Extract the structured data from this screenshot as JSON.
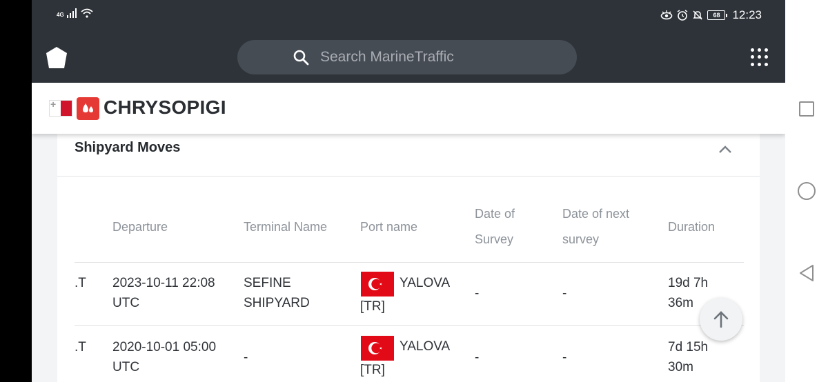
{
  "status_bar": {
    "network": "4G",
    "battery": "68",
    "time": "12:23"
  },
  "header": {
    "search_placeholder": "Search MarineTraffic"
  },
  "vessel": {
    "name": "CHRYSOPIGI",
    "flag": "Malta",
    "type_icon": "tanker-drops-icon"
  },
  "section": {
    "title": "Shipyard Moves",
    "columns": [
      "Departure",
      "Terminal Name",
      "Port name",
      "Date of",
      "Survey",
      "Date of next",
      "survey",
      "Duration"
    ],
    "rows": [
      {
        "clipped": ".T",
        "departure_1": "2023-10-11 22:08",
        "departure_2": "UTC",
        "terminal_1": "SEFINE",
        "terminal_2": "SHIPYARD",
        "port_1": "YALOVA",
        "port_2": "[TR]",
        "date_of_survey": "-",
        "date_of_next_survey": "-",
        "duration_1": "19d 7h",
        "duration_2": "36m"
      },
      {
        "clipped": ".T",
        "departure_1": "2020-10-01 05:00",
        "departure_2": "UTC",
        "terminal_1": "-",
        "terminal_2": "",
        "port_1": "YALOVA",
        "port_2": "[TR]",
        "date_of_survey": "-",
        "date_of_next_survey": "-",
        "duration_1": "7d 15h",
        "duration_2": "30m"
      }
    ]
  },
  "colors": {
    "topbar": "#2e3339",
    "search_bg": "#464c54",
    "accent_red": "#e53935",
    "turkey_red": "#e30a17"
  }
}
